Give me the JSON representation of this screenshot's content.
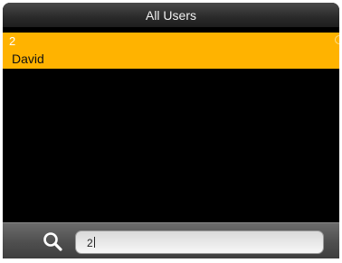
{
  "header": {
    "title": "All Users"
  },
  "users": [
    {
      "id": "2",
      "name": "David",
      "selected": true
    }
  ],
  "search": {
    "value": "2",
    "icon": "search-icon"
  },
  "colors": {
    "selected_row": "#ffb300",
    "background": "#000000",
    "title_text": "#f2f2f2"
  }
}
